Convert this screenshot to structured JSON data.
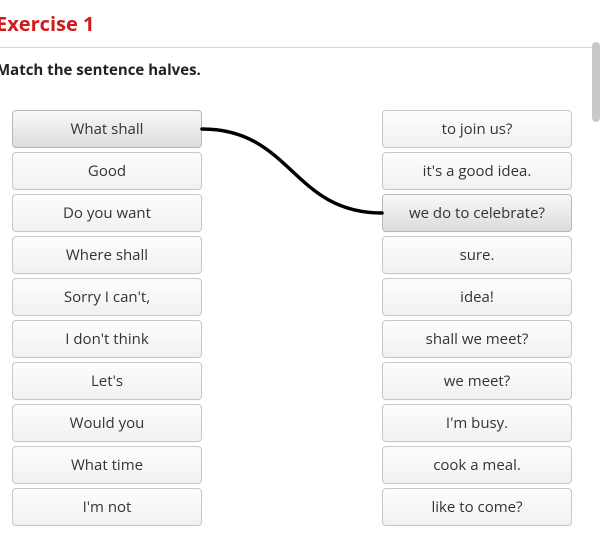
{
  "heading": "Exercise 1",
  "instruction": "Match the sentence halves.",
  "left": {
    "items": [
      "What shall",
      "Good",
      "Do you want",
      "Where shall",
      "Sorry I can't,",
      "I don't think",
      "Let's",
      "Would you",
      "What time",
      "I'm not"
    ],
    "selected_index": 0
  },
  "right": {
    "items": [
      "to join us?",
      "it's a good idea.",
      "we do to celebrate?",
      "sure.",
      "idea!",
      "shall we meet?",
      "we meet?",
      "I'm busy.",
      "cook a meal.",
      "like to come?"
    ],
    "selected_index": 2
  },
  "connections": [
    {
      "left_index": 0,
      "right_index": 2
    }
  ],
  "colors": {
    "heading": "#cf1b1b",
    "connection_stroke": "#000000"
  }
}
